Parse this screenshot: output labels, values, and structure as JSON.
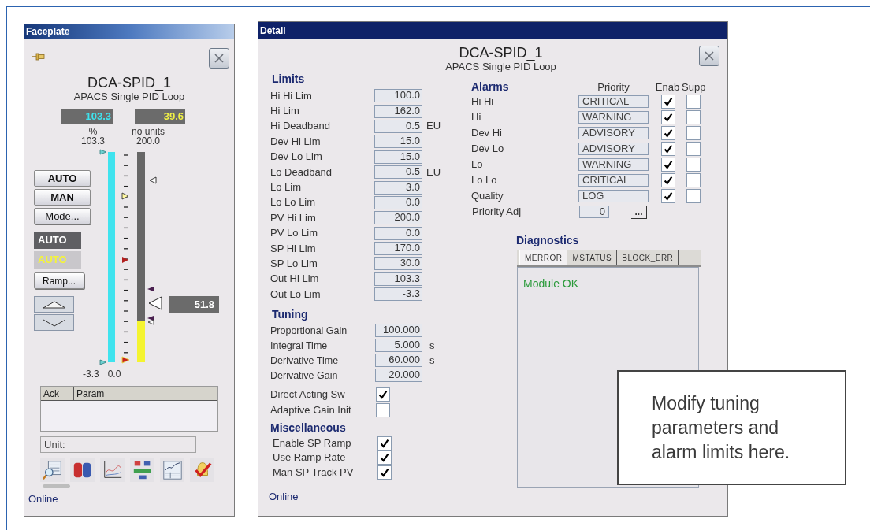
{
  "faceplate": {
    "title": "Faceplate",
    "tag": "DCA-SPID_1",
    "description": "APACS Single PID Loop",
    "output_value": "103.3",
    "pv_value": "39.6",
    "output_units": "%",
    "pv_units": "no units",
    "output_max": "103.3",
    "pv_max": "200.0",
    "output_min": "-3.3",
    "pv_min": "0.0",
    "output_bar": {
      "level": 1
    },
    "pv_bar": {
      "level": 0.198
    },
    "setpoint_value": "51.8",
    "buttons": [
      {
        "label": "AUTO"
      },
      {
        "label": "MAN"
      },
      {
        "label": "Mode..."
      }
    ],
    "mode_indicators": [
      {
        "label": "AUTO",
        "kind": "actual"
      },
      {
        "label": "AUTO",
        "kind": "target"
      }
    ],
    "ramp_button": "Ramp...",
    "alarm_table": {
      "columns": [
        "Ack",
        "Param"
      ]
    },
    "unit_field": "Unit:",
    "status": "Online"
  },
  "detail": {
    "title": "Detail",
    "tag": "DCA-SPID_1",
    "description": "APACS Single PID Loop",
    "limits": {
      "heading": "Limits",
      "rows": [
        {
          "label": "Hi Hi Lim",
          "value": "100.0"
        },
        {
          "label": "Hi Lim",
          "value": "162.0"
        },
        {
          "label": "Hi Deadband",
          "value": "0.5",
          "unit": "EU"
        },
        {
          "label": "Dev Hi Lim",
          "value": "15.0"
        },
        {
          "label": "Dev Lo Lim",
          "value": "15.0"
        },
        {
          "label": "Lo Deadband",
          "value": "0.5",
          "unit": "EU"
        },
        {
          "label": "Lo Lim",
          "value": "3.0"
        },
        {
          "label": "Lo Lo Lim",
          "value": "0.0"
        },
        {
          "label": "PV Hi Lim",
          "value": "200.0"
        },
        {
          "label": "PV Lo Lim",
          "value": "0.0"
        },
        {
          "label": "SP Hi Lim",
          "value": "170.0"
        },
        {
          "label": "SP Lo Lim",
          "value": "30.0"
        },
        {
          "label": "Out Hi Lim",
          "value": "103.3"
        },
        {
          "label": "Out Lo Lim",
          "value": "-3.3"
        }
      ]
    },
    "tuning": {
      "heading": "Tuning",
      "rows": [
        {
          "label": "Proportional Gain",
          "value": "100.000"
        },
        {
          "label": "Integral Time",
          "value": "5.000",
          "unit": "s"
        },
        {
          "label": "Derivative Time",
          "value": "60.000",
          "unit": "s"
        },
        {
          "label": "Derivative Gain",
          "value": "20.000"
        }
      ],
      "switches": [
        {
          "label": "Direct Acting Sw",
          "checked": true
        },
        {
          "label": "Adaptive Gain Init",
          "checked": false
        }
      ]
    },
    "miscellaneous": {
      "heading": "Miscellaneous",
      "rows": [
        {
          "label": "Enable SP Ramp",
          "checked": true
        },
        {
          "label": "Use Ramp Rate",
          "checked": true
        },
        {
          "label": "Man SP Track PV",
          "checked": true
        }
      ]
    },
    "alarms": {
      "heading": "Alarms",
      "columns": [
        "Priority",
        "Enab",
        "Supp"
      ],
      "rows": [
        {
          "label": "Hi Hi",
          "priority": "CRITICAL",
          "enabled": true,
          "suppressed": false
        },
        {
          "label": "Hi",
          "priority": "WARNING",
          "enabled": true,
          "suppressed": false
        },
        {
          "label": "Dev Hi",
          "priority": "ADVISORY",
          "enabled": true,
          "suppressed": false
        },
        {
          "label": "Dev Lo",
          "priority": "ADVISORY",
          "enabled": true,
          "suppressed": false
        },
        {
          "label": "Lo",
          "priority": "WARNING",
          "enabled": true,
          "suppressed": false
        },
        {
          "label": "Lo Lo",
          "priority": "CRITICAL",
          "enabled": true,
          "suppressed": false
        },
        {
          "label": "Quality",
          "priority": "LOG",
          "enabled": true,
          "suppressed": false
        }
      ],
      "priority_adj": {
        "label": "Priority Adj",
        "value": "0",
        "button": "..."
      }
    },
    "diagnostics": {
      "heading": "Diagnostics",
      "tabs": [
        {
          "label": "MERROR",
          "selected": true
        },
        {
          "label": "MSTATUS",
          "selected": false
        },
        {
          "label": "BLOCK_ERR",
          "selected": false
        }
      ],
      "messages": [
        "Module OK"
      ]
    },
    "status": "Online"
  },
  "callout": {
    "text": "Modify tuning parameters and alarm limits here."
  }
}
